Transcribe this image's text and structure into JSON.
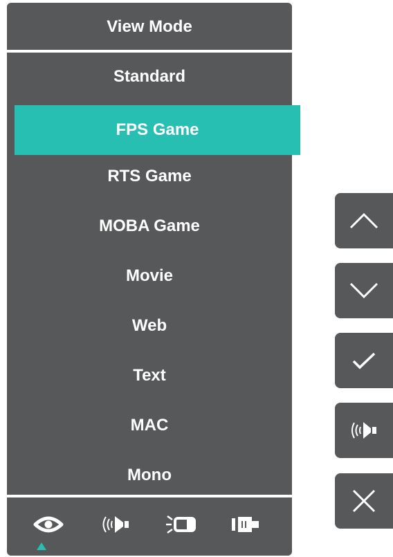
{
  "menu": {
    "title": "View Mode",
    "items": [
      {
        "label": "Standard"
      },
      {
        "label": "FPS Game",
        "selected": true
      },
      {
        "label": "RTS Game"
      },
      {
        "label": "MOBA Game"
      },
      {
        "label": "Movie"
      },
      {
        "label": "Web"
      },
      {
        "label": "Text"
      },
      {
        "label": "MAC"
      },
      {
        "label": "Mono"
      }
    ]
  },
  "tabbar": {
    "icons": [
      "eye-icon",
      "audio-icon",
      "brightness-icon",
      "input-source-icon"
    ],
    "active_index": 0
  },
  "keys": [
    "up-chevron-icon",
    "down-chevron-icon",
    "check-icon",
    "audio-icon",
    "close-icon"
  ],
  "colors": {
    "panel": "#575859",
    "accent": "#26bfb1",
    "text": "#ffffff"
  }
}
